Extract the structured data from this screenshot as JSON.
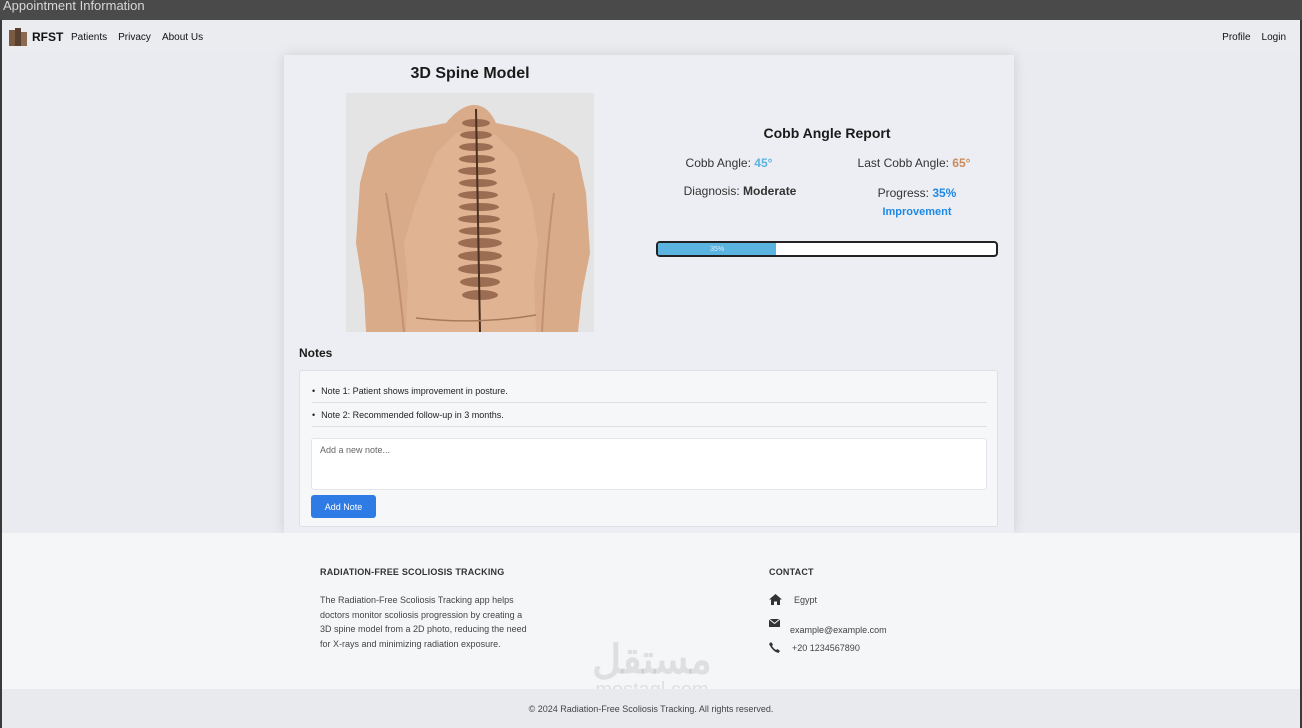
{
  "window": {
    "title": "Appointment Information"
  },
  "navbar": {
    "brand": "RFST",
    "links": [
      "Patients",
      "Privacy",
      "About Us"
    ],
    "right_links": [
      "Profile",
      "Login"
    ]
  },
  "spine": {
    "title": "3D Spine Model"
  },
  "report": {
    "title": "Cobb Angle Report",
    "cobb_label": "Cobb Angle:",
    "cobb_value": "45°",
    "last_label": "Last Cobb Angle:",
    "last_value": "65°",
    "diagnosis_label": "Diagnosis:",
    "diagnosis_value": "Moderate",
    "progress_label": "Progress:",
    "progress_value": "35%",
    "progress_text": "Improvement",
    "bar_label": "35%",
    "progress_fraction": 0.35
  },
  "notes": {
    "title": "Notes",
    "items": [
      "Note 1: Patient shows improvement in posture.",
      "Note 2: Recommended follow-up in 3 months."
    ],
    "input_placeholder": "Add a new note...",
    "add_button": "Add Note"
  },
  "footer": {
    "about_title": "RADIATION-FREE SCOLIOSIS TRACKING",
    "about_text": "The Radiation-Free Scoliosis Tracking app helps doctors monitor scoliosis progression by creating a 3D spine model from a 2D photo, reducing the need for X-rays and minimizing radiation exposure.",
    "contact_title": "CONTACT",
    "location": "Egypt",
    "email": "example@example.com",
    "phone": "+20 1234567890",
    "copyright": "© 2024 Radiation-Free Scoliosis Tracking. All rights reserved."
  },
  "watermark": {
    "arabic": "مستقل",
    "latin": "mostaql.com"
  },
  "colors": {
    "accent": "#2f7be5",
    "cobb_value": "#5bb3e0",
    "last_value": "#c98b5a",
    "progress": "#1e88e5"
  },
  "icons": [
    "home-icon",
    "envelope-icon",
    "phone-icon"
  ]
}
